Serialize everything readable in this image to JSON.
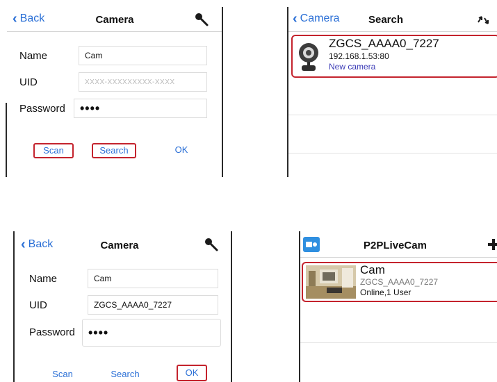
{
  "panel_add_1": {
    "back_label": "Back",
    "title": "Camera",
    "name_label": "Name",
    "name_value": "Cam",
    "uid_label": "UID",
    "uid_placeholder": "XXXX-XXXXXXXXX-XXXX",
    "password_label": "Password",
    "password_value": "••••",
    "scan_label": "Scan",
    "search_label": "Search",
    "ok_label": "OK"
  },
  "panel_search": {
    "back_label": "Camera",
    "title": "Search",
    "result": {
      "uid": "ZGCS_AAAA0_7227",
      "address": "192.168.1.53:80",
      "status": "New camera"
    }
  },
  "panel_add_2": {
    "back_label": "Back",
    "title": "Camera",
    "name_label": "Name",
    "name_value": "Cam",
    "uid_label": "UID",
    "uid_value": "ZGCS_AAAA0_7227",
    "password_label": "Password",
    "password_value": "••••",
    "scan_label": "Scan",
    "search_label": "Search",
    "ok_label": "OK"
  },
  "panel_list": {
    "title": "P2PLiveCam",
    "camera": {
      "name": "Cam",
      "uid": "ZGCS_AAAA0_7227",
      "status": "Online,1 User"
    }
  },
  "colors": {
    "accent": "#2a6fd6",
    "highlight": "#c4232d",
    "status_link": "#3b3bb6"
  }
}
